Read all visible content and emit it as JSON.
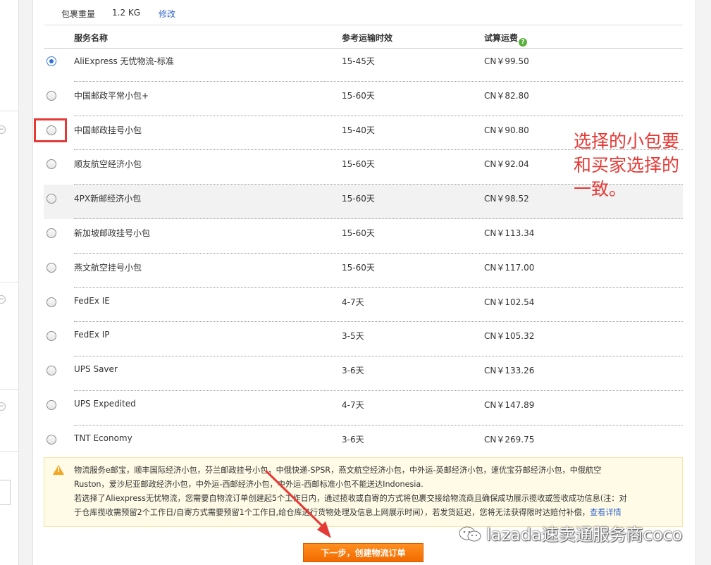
{
  "package": {
    "weight_label": "包裹重量",
    "weight_value": "1.2 KG",
    "edit_label": "修改"
  },
  "table": {
    "headers": {
      "service": "服务名称",
      "time": "参考运输时效",
      "fee": "试算运费",
      "help_glyph": "?"
    },
    "rows": [
      {
        "name": "AliExpress 无忧物流-标准",
        "time": "15-45天",
        "fee": "CN￥99.50",
        "selected": true
      },
      {
        "name": "中国邮政平常小包+",
        "time": "15-60天",
        "fee": "CN￥82.80",
        "selected": false
      },
      {
        "name": "中国邮政挂号小包",
        "time": "15-40天",
        "fee": "CN￥90.80",
        "selected": false
      },
      {
        "name": "顺友航空经济小包",
        "time": "15-60天",
        "fee": "CN￥92.04",
        "selected": false
      },
      {
        "name": "4PX新邮经济小包",
        "time": "15-60天",
        "fee": "CN￥98.52",
        "selected": false
      },
      {
        "name": "新加坡邮政挂号小包",
        "time": "15-60天",
        "fee": "CN￥113.34",
        "selected": false
      },
      {
        "name": "燕文航空挂号小包",
        "time": "15-60天",
        "fee": "CN￥117.00",
        "selected": false
      },
      {
        "name": "FedEx IE",
        "time": "4-7天",
        "fee": "CN￥102.54",
        "selected": false
      },
      {
        "name": "FedEx IP",
        "time": "3-5天",
        "fee": "CN￥105.32",
        "selected": false
      },
      {
        "name": "UPS Saver",
        "time": "3-6天",
        "fee": "CN￥133.26",
        "selected": false
      },
      {
        "name": "UPS Expedited",
        "time": "4-7天",
        "fee": "CN￥147.89",
        "selected": false
      },
      {
        "name": "TNT Economy",
        "time": "3-6天",
        "fee": "CN￥269.75",
        "selected": false
      }
    ]
  },
  "annotation": {
    "text_line1": "选择的小包要",
    "text_line2": "和买家选择的",
    "text_line3": "一致。",
    "color": "#e53935"
  },
  "notice": {
    "icon": "warning-icon",
    "icon_glyph": "!",
    "line1": "物流服务e邮宝，顺丰国际经济小包，芬兰邮政挂号小包，中俄快递-SPSR，燕文航空经济小包，中外运-英邮经济小包，速优宝芬邮经济小包，中俄航空",
    "line2": "Ruston，爱沙尼亚邮政经济小包，中外运-西邮经济小包，中外运-西邮标准小包不能送达Indonesia.",
    "line3": "若选择了Aliexpress无忧物流，您需要自物流订单创建起5个工作日内，通过揽收或自寄的方式将包裹交接给物流商且确保成功展示揽收或签收成功信息(注：对",
    "line4": "于仓库揽收需预留2个工作日/自寄方式需要预留1个工作日,给仓库进行货物处理及信息上网展示时间），若发货延迟，您将无法获得限时达赔付补偿，",
    "link": "查看详情"
  },
  "next_button": "下一步，创建物流订单",
  "watermark": "lazada速卖通服务商coco",
  "colors": {
    "accent_button": "#f26a00",
    "link": "#3366cc",
    "notice_bg": "#fffbe6",
    "radio_checked": "#2f72d6"
  }
}
